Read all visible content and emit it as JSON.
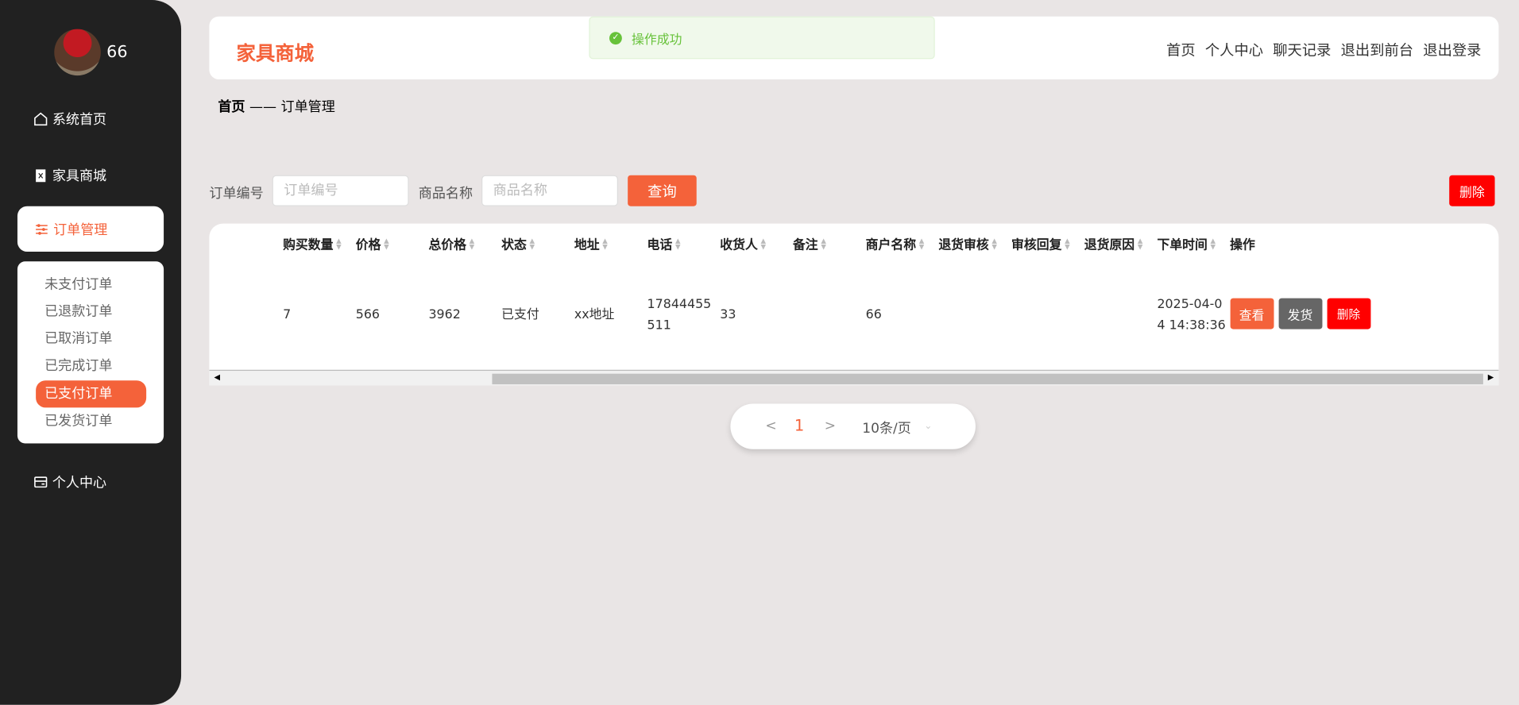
{
  "sidebar": {
    "username": "66",
    "items": [
      {
        "label": "系统首页",
        "icon": "home-icon"
      },
      {
        "label": "家具商城",
        "icon": "clipboard-icon"
      },
      {
        "label": "订单管理",
        "icon": "sliders-icon"
      },
      {
        "label": "个人中心",
        "icon": "wallet-icon"
      }
    ],
    "submenu": [
      "未支付订单",
      "已退款订单",
      "已取消订单",
      "已完成订单",
      "已支付订单",
      "已发货订单"
    ],
    "active_submenu": "已支付订单"
  },
  "header": {
    "brand": "家具商城",
    "links": [
      "首页",
      "个人中心",
      "聊天记录",
      "退出到前台",
      "退出登录"
    ]
  },
  "toast": {
    "message": "操作成功"
  },
  "breadcrumb": {
    "home": "首页",
    "sep": "——",
    "current": "订单管理"
  },
  "filters": {
    "order_no_label": "订单编号",
    "order_no_placeholder": "订单编号",
    "product_label": "商品名称",
    "product_placeholder": "商品名称",
    "search": "查询",
    "delete": "删除"
  },
  "table": {
    "columns": [
      "购买数量",
      "价格",
      "总价格",
      "状态",
      "地址",
      "电话",
      "收货人",
      "备注",
      "商户名称",
      "退货审核",
      "审核回复",
      "退货原因",
      "下单时间",
      "操作"
    ],
    "rows": [
      {
        "cells": [
          "7",
          "566",
          "3962",
          "已支付",
          "xx地址",
          "17844455511",
          "33",
          "",
          "66",
          "",
          "",
          "",
          "2025-04-04 14:38:36"
        ],
        "actions": [
          "查看",
          "发货",
          "删除"
        ]
      }
    ]
  },
  "pagination": {
    "prev": "<",
    "page": "1",
    "next": ">",
    "page_size": "10条/页"
  },
  "colors": {
    "accent": "#f4623a",
    "danger": "#ff0000",
    "gray": "#666666",
    "success": "#67c23a"
  }
}
